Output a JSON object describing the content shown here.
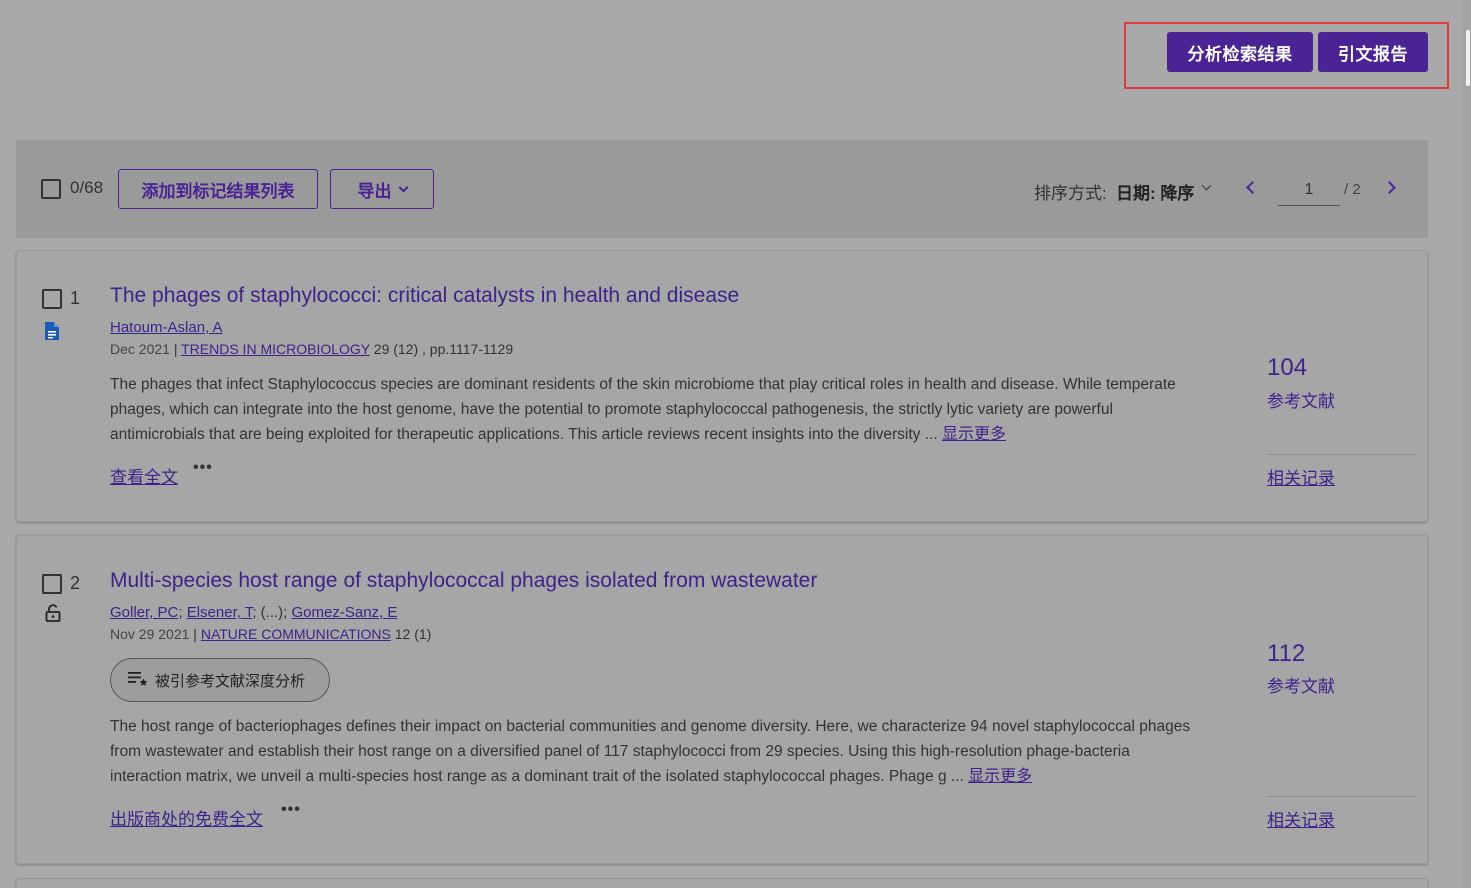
{
  "header_actions": {
    "analyze_label": "分析检索结果",
    "citation_report_label": "引文报告"
  },
  "toolbar": {
    "selection_count": "0/68",
    "add_to_marked_list_label": "添加到标记结果列表",
    "export_label": "导出",
    "sort_label": "排序方式:",
    "sort_value": "日期: 降序",
    "page_current": "1",
    "page_total": "/ 2"
  },
  "results": [
    {
      "index": "1",
      "title": "The phages of staphylococci: critical catalysts in health and disease",
      "authors": [
        "Hatoum-Aslan, A"
      ],
      "date": "Dec 2021",
      "journal": "TRENDS IN MICROBIOLOGY",
      "volume_pages": "29 (12) , pp.1117-1129",
      "abstract": "The phages that infect Staphylococcus species are dominant residents of the skin microbiome that play critical roles in health and disease. While temperate phages, which can integrate into the host genome, have the potential to promote staphylococcal pathogenesis, the strictly lytic variety are powerful antimicrobials that are being exploited for therapeutic applications. This article reviews recent insights into the diversity ...",
      "show_more": "显示更多",
      "fulltext_link": "查看全文",
      "more_options": "•••",
      "citation_count": "104",
      "citation_label": "参考文献",
      "related_records": "相关记录",
      "icon": "document-icon"
    },
    {
      "index": "2",
      "title": "Multi-species host range of staphylococcal phages isolated from wastewater",
      "authors": [
        "Goller, PC",
        "Elsener, T",
        "Gomez-Sanz, E"
      ],
      "authors_ellipsis": "(...);",
      "date": "Nov 29 2021",
      "journal": "NATURE COMMUNICATIONS",
      "volume_pages": "12 (1)",
      "analysis_pill": "被引参考文献深度分析",
      "abstract": "The host range of bacteriophages defines their impact on bacterial communities and genome diversity. Here, we characterize 94 novel staphylococcal phages from wastewater and establish their host range on a diversified panel of 117 staphylococci from 29 species. Using this high-resolution phage-bacteria interaction matrix, we unveil a multi-species host range as a dominant trait of the isolated staphylococcal phages. Phage g ...",
      "show_more": "显示更多",
      "fulltext_link": "出版商处的免费全文",
      "more_options": "•••",
      "citation_count": "112",
      "citation_label": "参考文献",
      "related_records": "相关记录",
      "icon": "open-lock-icon"
    }
  ],
  "colors": {
    "brand_purple": "#4a2495",
    "link_purple": "#3e238a",
    "highlight_box": "#e03c3c",
    "overlay_gray": "#a9a9a9"
  }
}
